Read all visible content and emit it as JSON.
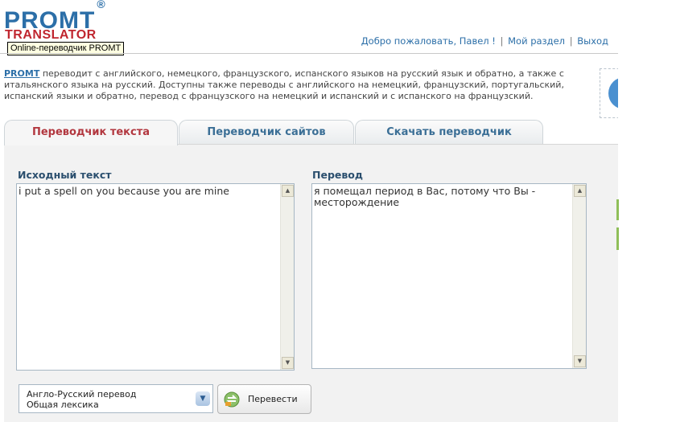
{
  "header": {
    "logo_main": "PROMT",
    "logo_reg": "®",
    "logo_sub": "TRANSLATOR",
    "tooltip": "Online-переводчик PROMT"
  },
  "userbar": {
    "welcome": "Добро пожаловать, Павел !",
    "my_section": "Мой раздел",
    "logout": "Выход",
    "separator": "|"
  },
  "description": {
    "link": "PROMT",
    "text": " переводит с английского, немецкого, французского, испанского языков на русский язык и обратно, а также с итальянского языка на русский. Доступны также переводы с английского на немецкий, французский, португальский, испанский языки и обратно, перевод с французского на немецкий и испанский и с испанского на французский."
  },
  "tabs": [
    {
      "label": "Переводчик текста",
      "active": true
    },
    {
      "label": "Переводчик сайтов",
      "active": false
    },
    {
      "label": "Скачать переводчик",
      "active": false
    }
  ],
  "source": {
    "label": "Исходный текст",
    "value": "i put a spell on you because you are mine"
  },
  "result": {
    "label": "Перевод",
    "value": "я помещал период в Вас, потому что Вы - месторождение"
  },
  "direction": {
    "line1": "Англо-Русский перевод",
    "line2": "Общая лексика"
  },
  "translate_button": {
    "label": "Перевести"
  },
  "colors": {
    "brand_blue": "#2c6fa8",
    "brand_red": "#c0262f",
    "active_tab": "#b2373f"
  }
}
